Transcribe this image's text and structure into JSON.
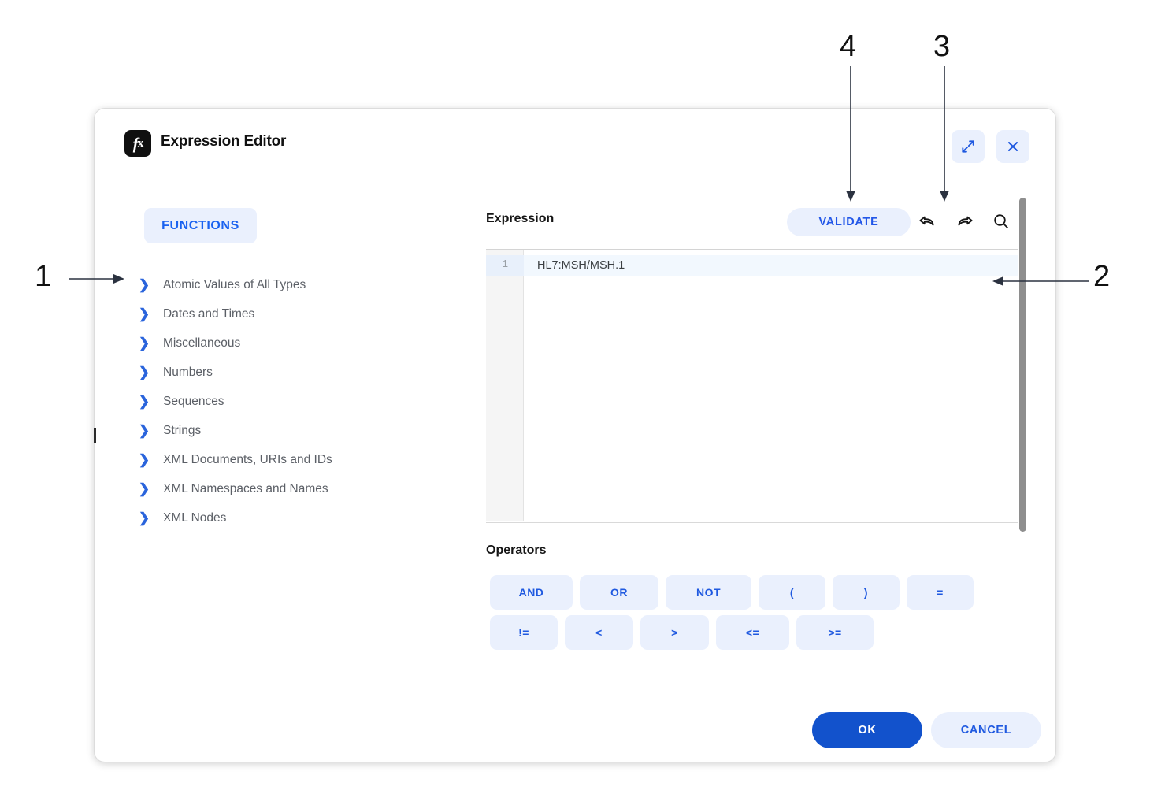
{
  "dialog": {
    "title": "Expression Editor",
    "icon": "fx-icon",
    "header_buttons": [
      {
        "name": "expand-icon",
        "label": "Expand"
      },
      {
        "name": "close-icon",
        "label": "Close"
      }
    ]
  },
  "left_panel": {
    "tab_label": "FUNCTIONS",
    "tree_items": [
      {
        "label": "Atomic Values of All Types"
      },
      {
        "label": "Dates and Times"
      },
      {
        "label": "Miscellaneous"
      },
      {
        "label": "Numbers"
      },
      {
        "label": "Sequences"
      },
      {
        "label": "Strings"
      },
      {
        "label": "XML Documents, URIs and IDs"
      },
      {
        "label": "XML Namespaces and Names"
      },
      {
        "label": "XML Nodes"
      }
    ]
  },
  "expression": {
    "label": "Expression",
    "validate_label": "VALIDATE",
    "toolbar_icons": [
      "undo-icon",
      "redo-icon",
      "search-icon"
    ],
    "line_number": "1",
    "code": "HL7:MSH/MSH.1"
  },
  "operators": {
    "label": "Operators",
    "row1": [
      "AND",
      "OR",
      "NOT",
      "(",
      ")",
      "="
    ],
    "row2": [
      "!=",
      "<",
      ">",
      "<=",
      ">="
    ]
  },
  "footer": {
    "ok_label": "OK",
    "cancel_label": "CANCEL"
  },
  "annotations": [
    {
      "number": "1"
    },
    {
      "number": "2"
    },
    {
      "number": "3"
    },
    {
      "number": "4"
    }
  ],
  "colors": {
    "accent_blue": "#1f59e0",
    "primary_button": "#1252cc",
    "pill_background": "#eaf0fd",
    "tree_text": "#5b5f66",
    "active_line": "#f2f8fe"
  }
}
